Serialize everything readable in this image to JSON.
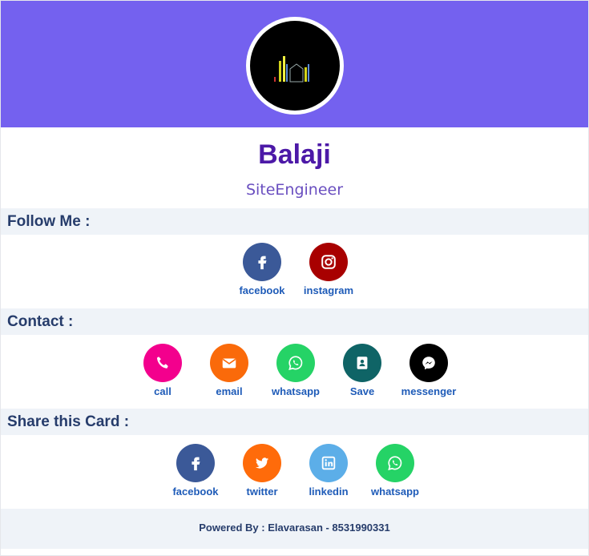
{
  "profile": {
    "name": "Balaji",
    "title": "SiteEngineer"
  },
  "follow": {
    "heading": "Follow Me :",
    "items": [
      {
        "label": "facebook",
        "icon": "facebook-icon",
        "color": "#3b5998"
      },
      {
        "label": "instagram",
        "icon": "instagram-icon",
        "color": "#a80000"
      }
    ]
  },
  "contact": {
    "heading": "Contact :",
    "items": [
      {
        "label": "call",
        "icon": "phone-icon",
        "color": "#f3008d"
      },
      {
        "label": "email",
        "icon": "envelope-icon",
        "color": "#fa6a0a"
      },
      {
        "label": "whatsapp",
        "icon": "whatsapp-icon",
        "color": "#25d366"
      },
      {
        "label": "Save",
        "icon": "contact-book-icon",
        "color": "#0f6466"
      },
      {
        "label": "messenger",
        "icon": "messenger-icon",
        "color": "#000000"
      }
    ]
  },
  "share": {
    "heading": "Share this Card :",
    "items": [
      {
        "label": "facebook",
        "icon": "facebook-icon",
        "color": "#3b5998"
      },
      {
        "label": "twitter",
        "icon": "twitter-icon",
        "color": "#ff6b0a"
      },
      {
        "label": "linkedin",
        "icon": "linkedin-icon",
        "color": "#5caee8"
      },
      {
        "label": "whatsapp",
        "icon": "whatsapp-icon",
        "color": "#25d366"
      }
    ]
  },
  "footer": {
    "text": "Powered By : Elavarasan - 8531990331"
  },
  "colors": {
    "banner": "#7461ef",
    "name": "#4c19a7",
    "section_bg": "#eff3f8",
    "link": "#1e5bb8"
  }
}
